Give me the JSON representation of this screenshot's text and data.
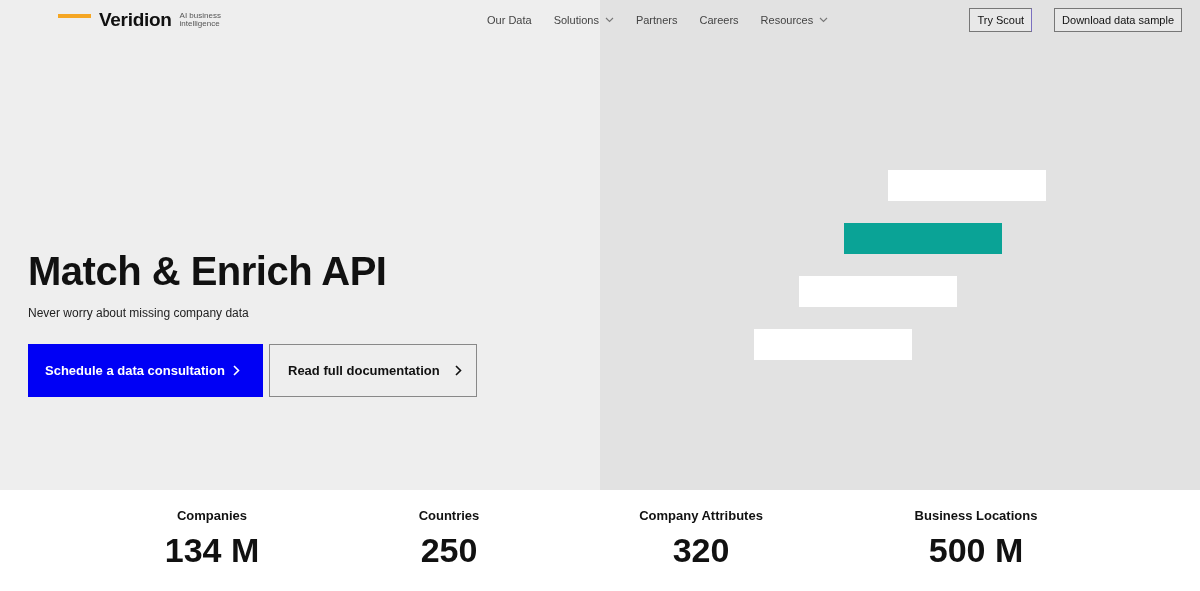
{
  "header": {
    "logo": {
      "name": "Veridion",
      "tagline": "AI business intelligence"
    },
    "nav": [
      {
        "label": "Our Data",
        "dropdown": false
      },
      {
        "label": "Solutions",
        "dropdown": true
      },
      {
        "label": "Partners",
        "dropdown": false
      },
      {
        "label": "Careers",
        "dropdown": false
      },
      {
        "label": "Resources",
        "dropdown": true
      }
    ],
    "actions": [
      "Try Scout",
      "Download data sample"
    ]
  },
  "hero": {
    "title": "Match & Enrich API",
    "subtitle": "Never worry about missing company data",
    "buttons": [
      {
        "label": "Schedule a data consultation",
        "kind": "primary"
      },
      {
        "label": "Read full documentation",
        "kind": "secondary"
      }
    ]
  },
  "stats": [
    {
      "label": "Companies",
      "value": "134 M"
    },
    {
      "label": "Countries",
      "value": "250"
    },
    {
      "label": "Company Attributes",
      "value": "320"
    },
    {
      "label": "Business Locations",
      "value": "500 M"
    }
  ]
}
